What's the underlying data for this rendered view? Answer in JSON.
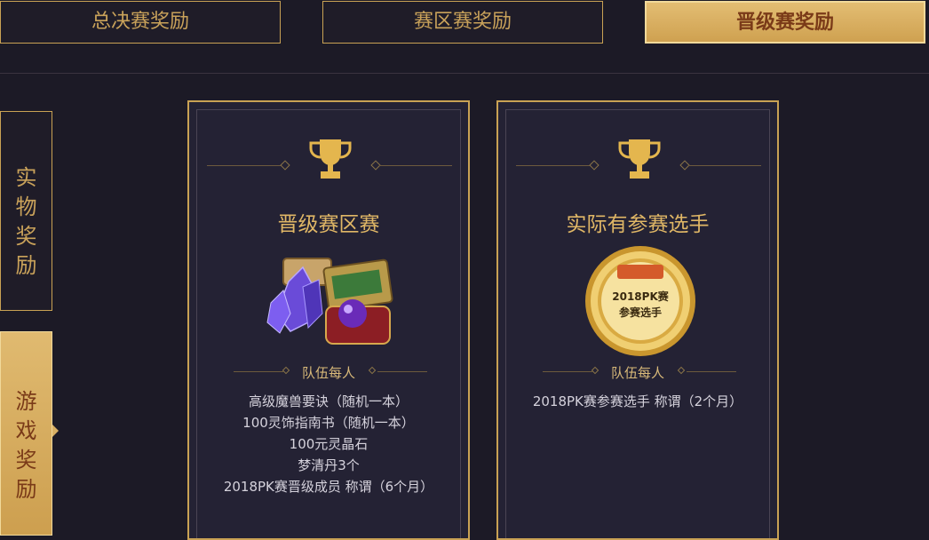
{
  "tabs": [
    {
      "label": "总决赛奖励"
    },
    {
      "label": "赛区赛奖励"
    },
    {
      "label": "晋级赛奖励"
    }
  ],
  "side_tabs": [
    {
      "label": "实物奖励"
    },
    {
      "label": "游戏奖励"
    }
  ],
  "cards": [
    {
      "title": "晋级赛区赛",
      "per_label": "队伍每人",
      "items": [
        "高级魔兽要诀（随机一本）",
        "100灵饰指南书（随机一本）",
        "100元灵晶石",
        "梦清丹3个",
        "2018PK赛晋级成员 称谓（6个月）"
      ]
    },
    {
      "title": "实际有参赛选手",
      "per_label": "队伍每人",
      "medal_line1": "2018PK赛",
      "medal_line2": "参赛选手",
      "items": [
        "2018PK赛参赛选手 称谓（2个月）"
      ]
    }
  ],
  "colors": {
    "gold": "#c9a254",
    "background": "#1c1a26",
    "card": "#242234",
    "active_text": "#7a3a18"
  }
}
